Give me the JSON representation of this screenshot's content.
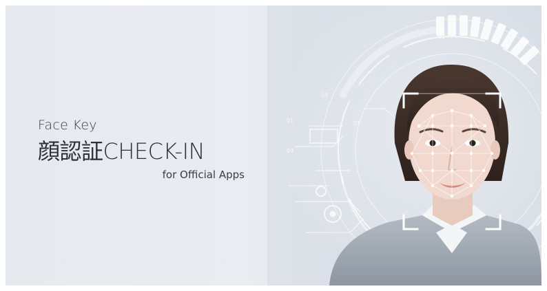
{
  "banner": {
    "subtitle": "Face Key",
    "title": "顔認証CHECK-IN",
    "tagline": "for Official Apps"
  },
  "hud": {
    "labels": [
      "01",
      "02",
      "03",
      "01",
      "0X",
      "02"
    ]
  },
  "colors": {
    "background": "#e6e9ee",
    "text": "#2f3338",
    "hud_line": "#ffffff",
    "suit": "#9aa3ad",
    "skin": "#f1d9cf",
    "hair": "#3b2c26"
  }
}
